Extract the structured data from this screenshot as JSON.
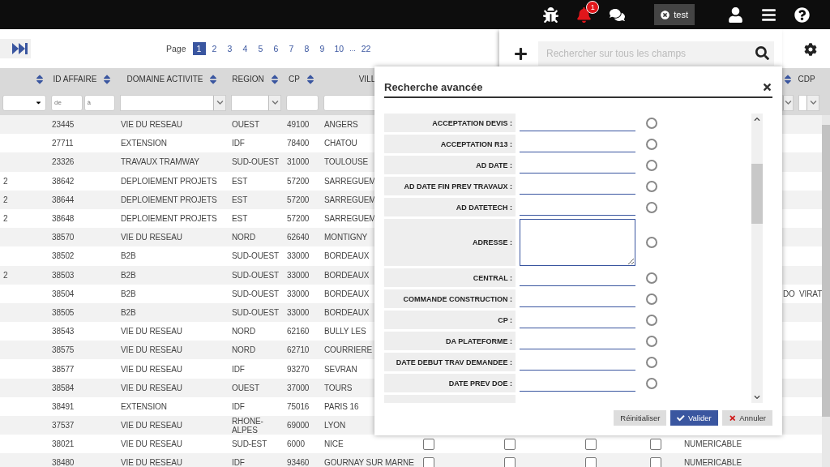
{
  "top_bar": {
    "notification_count": "1",
    "user_chip": "test"
  },
  "pagination": {
    "label": "Page",
    "pages": [
      {
        "kind": "page",
        "label": "1",
        "selected": true
      },
      {
        "kind": "page",
        "label": "2",
        "selected": false
      },
      {
        "kind": "page",
        "label": "3",
        "selected": false
      },
      {
        "kind": "page",
        "label": "4",
        "selected": false
      },
      {
        "kind": "page",
        "label": "5",
        "selected": false
      },
      {
        "kind": "page",
        "label": "6",
        "selected": false
      },
      {
        "kind": "page",
        "label": "7",
        "selected": false
      },
      {
        "kind": "page",
        "label": "8",
        "selected": false
      },
      {
        "kind": "page",
        "label": "9",
        "selected": false
      },
      {
        "kind": "page",
        "label": "10",
        "selected": false
      },
      {
        "kind": "ellipsis",
        "label": "..."
      },
      {
        "kind": "page",
        "label": "22",
        "selected": false
      }
    ]
  },
  "search": {
    "placeholder": "Rechercher sur tous les champs"
  },
  "table": {
    "columns": [
      {
        "kind": "sortable",
        "filter": {
          "kind": "select"
        }
      },
      {
        "kind": "sortable",
        "label": "ID AFFAIRE",
        "filter": {
          "kind": "range",
          "from_placeholder": "de",
          "to_placeholder": "à"
        }
      },
      {
        "kind": "sortable",
        "label": "DOMAINE ACTIVITE",
        "filter": {
          "kind": "combo"
        }
      },
      {
        "kind": "sortable",
        "label": "REGION",
        "filter": {
          "kind": "combo"
        }
      },
      {
        "kind": "sortable",
        "label": "CP",
        "filter": {
          "kind": "text"
        }
      },
      {
        "kind": "plain",
        "label": "VILL",
        "filter": {
          "kind": "text"
        }
      },
      {
        "kind": "hidden"
      },
      {
        "kind": "hidden"
      },
      {
        "kind": "hidden"
      },
      {
        "kind": "hidden"
      },
      {
        "kind": "hidden"
      },
      {
        "kind": "sortable",
        "filter": {
          "kind": "combo"
        }
      },
      {
        "kind": "sortable",
        "label": "CDP",
        "filter": {
          "kind": "combo"
        }
      }
    ],
    "rows": [
      {
        "cells": [
          null,
          "23445",
          "VIE DU RESEAU",
          "OUEST",
          "49100",
          "ANGERS"
        ]
      },
      {
        "cells": [
          null,
          "27711",
          "EXTENSION",
          "IDF",
          "78400",
          "CHATOU"
        ]
      },
      {
        "cells": [
          null,
          "23326",
          "TRAVAUX TRAMWAY",
          "SUD-OUEST",
          "31000",
          "TOULOUSE"
        ]
      },
      {
        "cells": [
          "2",
          "38642",
          "DEPLOIEMENT PROJETS",
          "EST",
          "57200",
          "SARREGUEM"
        ]
      },
      {
        "cells": [
          "2",
          "38644",
          "DEPLOIEMENT PROJETS",
          "EST",
          "57200",
          "SARREGUEM"
        ]
      },
      {
        "cells": [
          "2",
          "38648",
          "DEPLOIEMENT PROJETS",
          "EST",
          "57200",
          "SARREGUEM"
        ]
      },
      {
        "cells": [
          null,
          "38570",
          "VIE DU RESEAU",
          "NORD",
          "62640",
          "MONTIGNY"
        ]
      },
      {
        "cells": [
          null,
          "38502",
          "B2B",
          "SUD-OUEST",
          "33000",
          "BORDEAUX"
        ]
      },
      {
        "cells": [
          "2",
          "38503",
          "B2B",
          "SUD-OUEST",
          "33000",
          "BORDEAUX"
        ]
      },
      {
        "cells": [
          null,
          "38504",
          "B2B",
          "SUD-OUEST",
          "33000",
          "BORDEAUX",
          null,
          null,
          null,
          null,
          null,
          "DO",
          "VIRAT"
        ]
      },
      {
        "cells": [
          null,
          "38505",
          "B2B",
          "SUD-OUEST",
          "33000",
          "BORDEAUX"
        ]
      },
      {
        "cells": [
          null,
          "38543",
          "VIE DU RESEAU",
          "NORD",
          "62160",
          "BULLY LES"
        ]
      },
      {
        "cells": [
          null,
          "38575",
          "VIE DU RESEAU",
          "NORD",
          "62710",
          "COURRIERE"
        ]
      },
      {
        "cells": [
          null,
          "38577",
          "VIE DU RESEAU",
          "IDF",
          "93270",
          "SEVRAN"
        ]
      },
      {
        "cells": [
          null,
          "38584",
          "VIE DU RESEAU",
          "OUEST",
          "37000",
          "TOURS"
        ]
      },
      {
        "cells": [
          null,
          "38491",
          "EXTENSION",
          "IDF",
          "75016",
          "PARIS 16"
        ]
      },
      {
        "cells": [
          null,
          "37537",
          "VIE DU RESEAU",
          "RHONE-ALPES",
          "69000",
          "LYON"
        ]
      },
      {
        "cells": [
          null,
          "38021",
          "VIE DU RESEAU",
          "SUD-EST",
          "6000",
          "NICE",
          {
            "checked": false
          },
          {
            "checked": false
          },
          {
            "checked": false
          },
          {
            "checked": false
          },
          "NUMERICABLE"
        ]
      },
      {
        "cells": [
          null,
          "38480",
          "VIE DU RESEAU",
          "IDF",
          "93460",
          "GOURNAY SUR MARNE",
          {
            "checked": false
          },
          {
            "checked": false
          },
          {
            "checked": false
          },
          {
            "checked": false
          },
          "NUMERICABLE"
        ]
      }
    ]
  },
  "advanced_search": {
    "title": "Recherche avancée",
    "fields": [
      {
        "kind": "line",
        "label": "ACCEPTATION DEVIS :",
        "selected": false
      },
      {
        "kind": "line",
        "label": "ACCEPTATION R13 :",
        "selected": false
      },
      {
        "kind": "line",
        "label": "AD DATE :",
        "selected": false
      },
      {
        "kind": "line",
        "label": "AD DATE FIN PREV TRAVAUX :",
        "selected": false
      },
      {
        "kind": "line",
        "label": "AD DATETECH :",
        "selected": false
      },
      {
        "kind": "textarea",
        "label": "ADRESSE :",
        "selected": false
      },
      {
        "kind": "line",
        "label": "CENTRAL :",
        "selected": false
      },
      {
        "kind": "line",
        "label": "COMMANDE CONSTRUCTION :",
        "selected": false
      },
      {
        "kind": "line",
        "label": "CP :",
        "selected": false
      },
      {
        "kind": "line",
        "label": "DA PLATEFORME :",
        "selected": false
      },
      {
        "kind": "line",
        "label": "DATE DEBUT TRAV DEMANDEE :",
        "selected": false
      },
      {
        "kind": "line",
        "label": "DATE PREV DOE :",
        "selected": false
      }
    ],
    "buttons": [
      {
        "kind": "reset",
        "label": "Réinitialiser"
      },
      {
        "kind": "submit",
        "label": "Valider"
      },
      {
        "kind": "cancel",
        "label": "Annuler"
      }
    ]
  }
}
